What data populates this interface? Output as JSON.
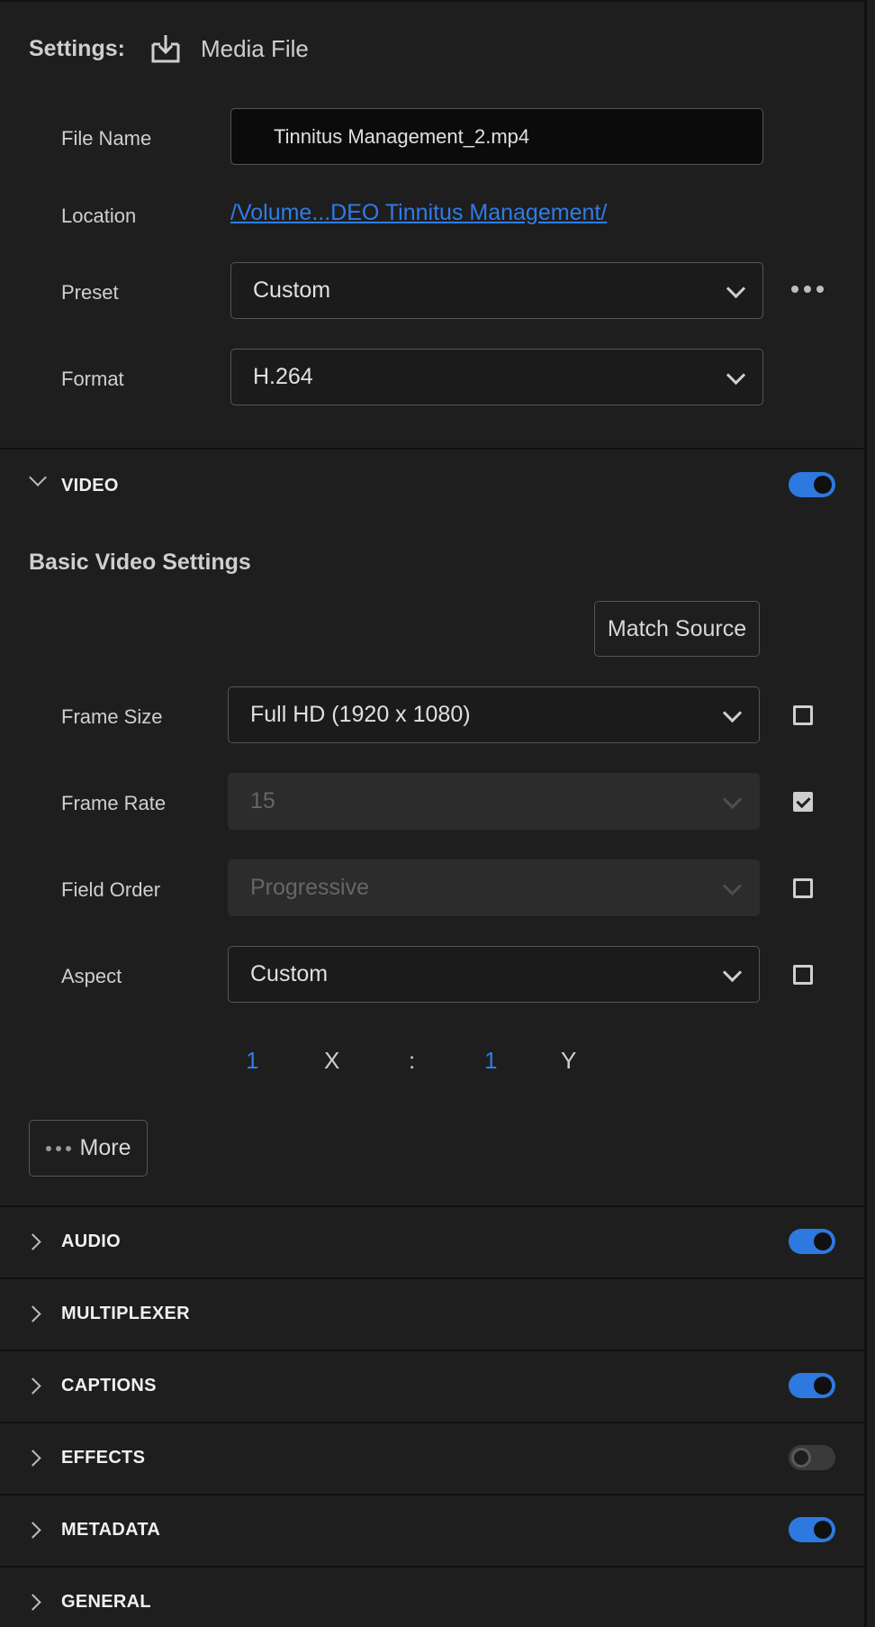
{
  "settings": {
    "label": "Settings:",
    "destination_icon": "download-icon",
    "destination_label": "Media File"
  },
  "fields": {
    "file_name_label": "File Name",
    "file_name_value": "Tinnitus Management_2.mp4",
    "location_label": "Location",
    "location_value": "/Volume...DEO Tinnitus Management/",
    "preset_label": "Preset",
    "preset_value": "Custom",
    "preset_more_icon": "more-horizontal-icon",
    "format_label": "Format",
    "format_value": "H.264"
  },
  "video": {
    "title": "VIDEO",
    "enabled": true,
    "basic_heading": "Basic Video Settings",
    "match_source_label": "Match Source",
    "frame_size_label": "Frame Size",
    "frame_size_value": "Full HD (1920 x 1080)",
    "frame_size_checked": false,
    "frame_rate_label": "Frame Rate",
    "frame_rate_value": "15",
    "frame_rate_checked": true,
    "field_order_label": "Field Order",
    "field_order_value": "Progressive",
    "field_order_checked": false,
    "aspect_label": "Aspect",
    "aspect_value": "Custom",
    "aspect_checked": false,
    "aspect_x_value": "1",
    "aspect_x_label": "X",
    "aspect_separator": ":",
    "aspect_y_value": "1",
    "aspect_y_label": "Y",
    "more_label": "More"
  },
  "sections": [
    {
      "title": "AUDIO",
      "has_toggle": true,
      "enabled": true
    },
    {
      "title": "MULTIPLEXER",
      "has_toggle": false
    },
    {
      "title": "CAPTIONS",
      "has_toggle": true,
      "enabled": true
    },
    {
      "title": "EFFECTS",
      "has_toggle": true,
      "enabled": false
    },
    {
      "title": "METADATA",
      "has_toggle": true,
      "enabled": true
    },
    {
      "title": "GENERAL",
      "has_toggle": false
    }
  ],
  "colors": {
    "background": "#1e1e1e",
    "accent": "#2d79e0",
    "link": "#2f7ce6"
  }
}
